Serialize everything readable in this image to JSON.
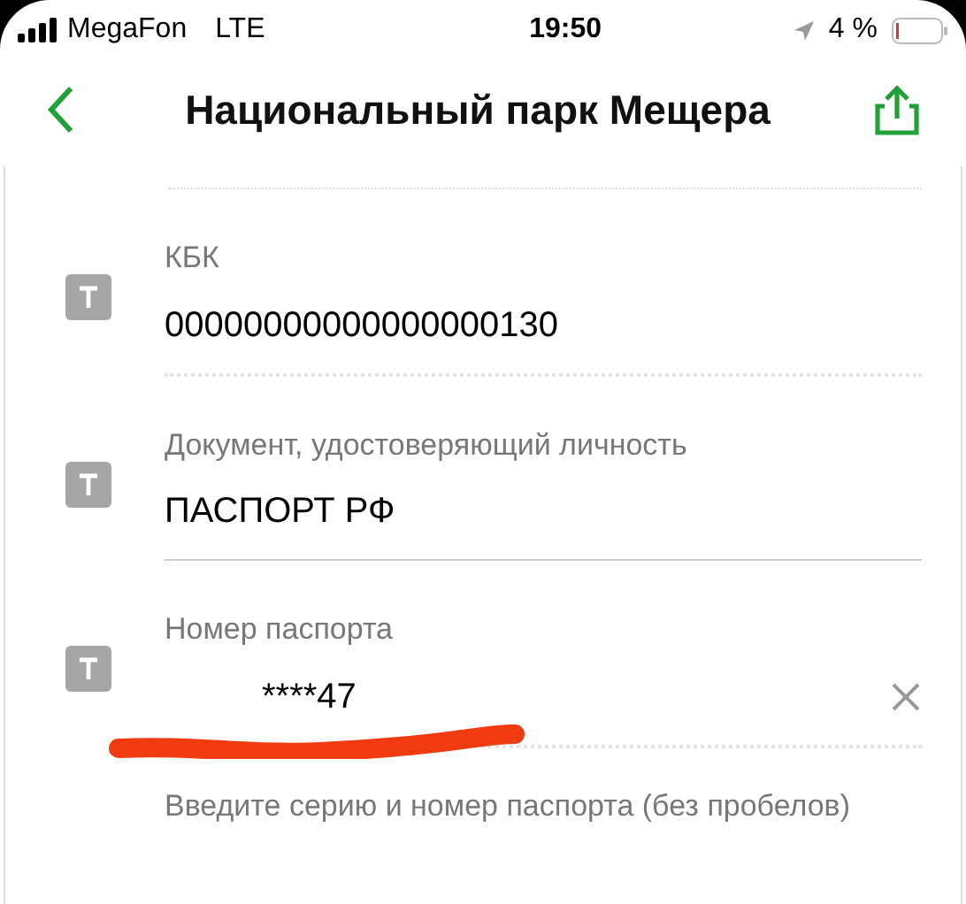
{
  "status_bar": {
    "carrier": "MegaFon",
    "network": "LTE",
    "time": "19:50",
    "battery": "4 %"
  },
  "header": {
    "title": "Национальный парк Мещера"
  },
  "fields": [
    {
      "label": "КБК",
      "value": "00000000000000000130",
      "divider_dotted": true,
      "clearable": false,
      "redacted": false
    },
    {
      "label": "Документ, удостоверяющий личность",
      "value": "ПАСПОРТ РФ",
      "divider_dotted": false,
      "clearable": false,
      "redacted": false
    },
    {
      "label": "Номер паспорта",
      "value": "****47",
      "divider_dotted": true,
      "clearable": true,
      "redacted": true,
      "hint": "Введите серию и номер паспорта (без пробелов)"
    }
  ]
}
